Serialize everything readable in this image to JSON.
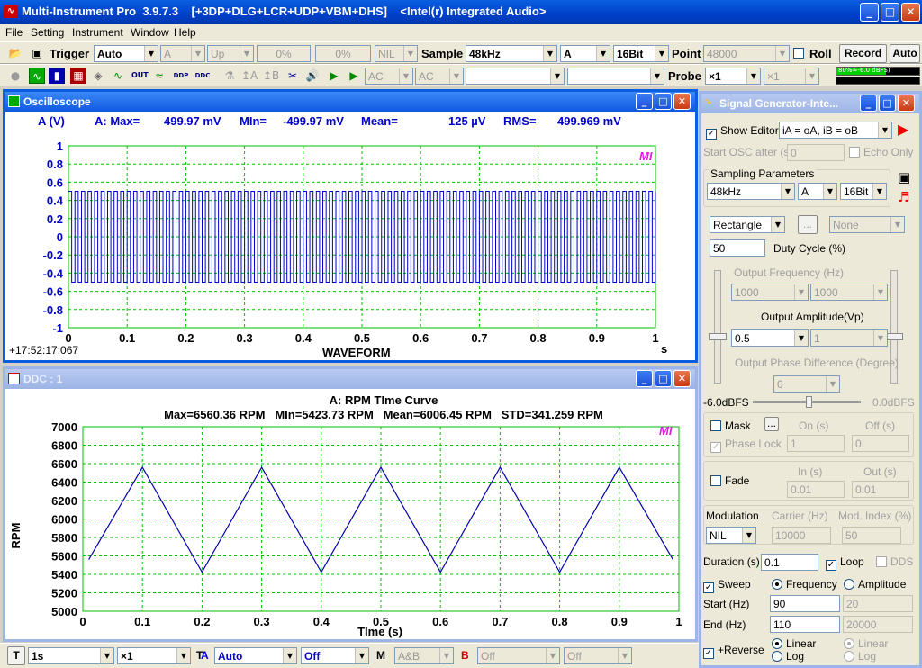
{
  "app": {
    "title": "Multi-Instrument Pro  3.9.7.3    [+3DP+DLG+LCR+UDP+VBM+DHS]    <Intel(r) Integrated Audio>"
  },
  "menu": [
    "File",
    "Setting",
    "Instrument",
    "Window",
    "Help"
  ],
  "toolbar1": {
    "trigger_label": "Trigger",
    "trigger_mode": "Auto",
    "channel": "A",
    "slope": "Up",
    "level1": "0%",
    "level2": "0%",
    "nil": "NIL",
    "sample_label": "Sample",
    "sample_rate": "48kHz",
    "sample_channel": "A",
    "bit_depth": "16Bit",
    "point_label": "Point",
    "point_value": "48000",
    "roll_label": "Roll",
    "record_label": "Record",
    "auto_label": "Auto"
  },
  "toolbar2": {
    "icons": [
      "stop-icon",
      "oscilloscope-icon",
      "spectrum-icon",
      "spectrogram-icon",
      "phase-icon",
      "generator-icon",
      "output-icon",
      "ddp-icon",
      "ddc-icon",
      "lab-icon",
      "ref-a-icon",
      "ref-b-icon",
      "tools-icon",
      "speaker-icon",
      "play-icon",
      "play-record-icon"
    ],
    "coupling_a": "AC",
    "coupling_b": "AC",
    "probe_label": "Probe",
    "probe_a": "×1",
    "probe_b": "×1",
    "level_meter": "80%≈-6.0 dBFS)"
  },
  "oscilloscope": {
    "title": "Oscilloscope",
    "readout": {
      "channel": "A (V)",
      "max_label": "A: Max=",
      "max": "499.97 mV",
      "min_label": "MIn=",
      "min": "-499.97 mV",
      "mean_label": "Mean=",
      "mean": "125  µV",
      "rms_label": "RMS=",
      "rms": "499.969 mV"
    },
    "xlabel": "WAVEFORM",
    "xunit": "s",
    "timestamp": "+17:52:17:067",
    "logo": "MI",
    "chart_data": {
      "type": "line",
      "xlabel": "WAVEFORM",
      "ylabel": "A (V)",
      "xlim": [
        0,
        1
      ],
      "ylim": [
        -1,
        1
      ],
      "xticks": [
        "0",
        "0.1",
        "0.2",
        "0.3",
        "0.4",
        "0.5",
        "0.6",
        "0.7",
        "0.8",
        "0.9",
        "1"
      ],
      "yticks": [
        "1",
        "0.8",
        "0.6",
        "0.4",
        "0.2",
        "0",
        "-0.2",
        "-0.4",
        "-0.6",
        "-0.8",
        "-1"
      ],
      "signal": {
        "shape": "rectangle",
        "amplitude": 0.5,
        "frequency_hz": 90,
        "sweep_to_hz": 110
      },
      "grid": true
    }
  },
  "ddc": {
    "title": "DDC : 1",
    "chart_data": {
      "type": "line",
      "title": "A: RPM TIme Curve",
      "subtitle": "Max=6560.36 RPM   MIn=5423.73 RPM   Mean=6006.45 RPM   STD=341.259 RPM",
      "xlabel": "TIme (s)",
      "ylabel": "RPM",
      "xlim": [
        0,
        1
      ],
      "ylim": [
        5000,
        7000
      ],
      "xticks": [
        "0",
        "0.1",
        "0.2",
        "0.3",
        "0.4",
        "0.5",
        "0.6",
        "0.7",
        "0.8",
        "0.9",
        "1"
      ],
      "yticks": [
        "7000",
        "6800",
        "6600",
        "6400",
        "6200",
        "6000",
        "5800",
        "5600",
        "5400",
        "5200",
        "5000"
      ],
      "x": [
        0.01,
        0.1,
        0.2,
        0.3,
        0.4,
        0.5,
        0.6,
        0.7,
        0.8,
        0.9,
        0.99
      ],
      "y": [
        5560,
        6560,
        5424,
        6560,
        5424,
        6560,
        5424,
        6560,
        5424,
        6560,
        5560
      ],
      "logo": "MI",
      "grid": true
    }
  },
  "siggen": {
    "title": "Signal Generator-Inte...",
    "show_editor": "Show Editor",
    "expression": "iA = oA, iB = oB",
    "start_osc_label": "Start OSC after (s)",
    "start_osc_value": "0",
    "echo_only": "Echo Only",
    "sampling_label": "Sampling Parameters",
    "rate": "48kHz",
    "channel": "A",
    "bits": "16Bit",
    "waveform": "Rectangle",
    "browse": "...",
    "wave_b": "None",
    "duty_value": "50",
    "duty_label": "Duty Cycle (%)",
    "freq_label": "Output Frequency (Hz)",
    "freq_a": "1000",
    "freq_b": "1000",
    "amp_label": "Output Amplitude(Vp)",
    "amp_a": "0.5",
    "amp_b": "1",
    "phase_label": "Output Phase Difference (Degree)",
    "phase_value": "0",
    "level_min": "-6.0dBFS",
    "level_max": "0.0dBFS",
    "mask_label": "Mask",
    "mask_btn": "...",
    "on_label": "On (s)",
    "off_label": "Off (s)",
    "phase_lock": "Phase Lock",
    "on_value": "1",
    "off_value": "0",
    "fade_label": "Fade",
    "in_label": "In (s)",
    "out_label": "Out (s)",
    "in_value": "0.01",
    "out_value": "0.01",
    "modulation_label": "Modulation",
    "carrier_label": "Carrier (Hz)",
    "mod_index_label": "Mod. Index (%)",
    "modulation": "NIL",
    "carrier_value": "10000",
    "mod_index_value": "50",
    "duration_label": "Duration (s)",
    "duration": "0.1",
    "loop_label": "Loop",
    "dds_label": "DDS",
    "sweep_label": "Sweep",
    "frequency_label": "Frequency",
    "amplitude_label": "Amplitude",
    "start_label": "Start (Hz)",
    "start_value": "90",
    "start_value_b": "20",
    "end_label": "End (Hz)",
    "end_value": "110",
    "end_value_b": "20000",
    "reverse_label": "+Reverse",
    "linear_label": "Linear",
    "log_label": "Log",
    "linear_label_b": "Linear",
    "log_label_b": "Log"
  },
  "statusbar": {
    "t_label": "T",
    "timebase": "1s",
    "t_zoom": "×1",
    "t_label2": "T",
    "a_label": "A",
    "a_range": "Auto",
    "a_state": "Off",
    "m_label": "M",
    "m_mode": "A&B",
    "b_label": "B",
    "b_range": "Off",
    "b_state": "Off"
  },
  "colors": {
    "accent": "#0a5fe0",
    "trace": "#0000cc",
    "grid": "#00c000",
    "logo": "#e020e0"
  }
}
